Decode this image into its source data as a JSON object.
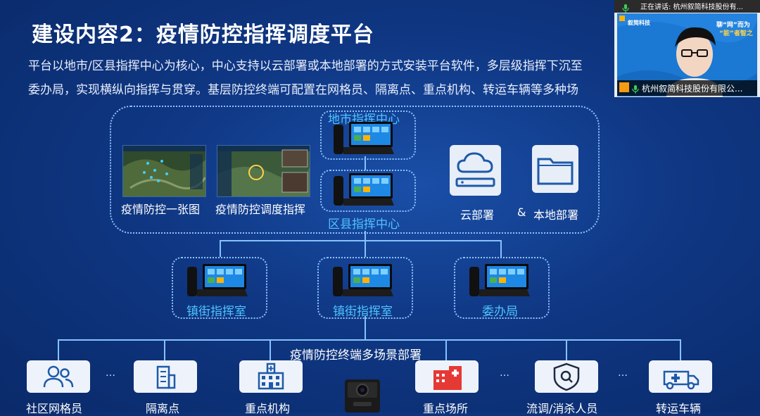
{
  "slide": {
    "title": "建设内容2：疫情防控指挥调度平台",
    "para_line1": "平台以地市/区县指挥中心为核心，中心支持以云部署或本地部署的方式安装平台软件，多层级指挥下沉至",
    "para_line2": "委办局，实现横纵向指挥与贯穿。基层防控终端可配置在网格员、隔离点、重点机构、转运车辆等多种场"
  },
  "top_panel": {
    "map1_label": "疫情防控一张图",
    "map2_label": "疫情防控调度指挥",
    "city_center": "地市指挥中心",
    "county_center": "区县指挥中心",
    "cloud_label": "云部署",
    "amp": "&",
    "local_label": "本地部署"
  },
  "mid_nodes": [
    {
      "label": "镇街指挥室"
    },
    {
      "label": "镇街指挥室"
    },
    {
      "label": "委办局"
    }
  ],
  "terminal_title": "疫情防控终端多场景部署",
  "terminals": [
    {
      "label": "社区网格员",
      "icon": "people-icon"
    },
    {
      "label": "隔离点",
      "icon": "building-icon"
    },
    {
      "label": "重点机构",
      "icon": "hospital-icon"
    },
    {
      "label": "重点场所",
      "icon": "venue-icon"
    },
    {
      "label": "流调/消杀人员",
      "icon": "shield-search-icon"
    },
    {
      "label": "转运车辆",
      "icon": "ambulance-icon"
    }
  ],
  "ellipsis": "…",
  "video": {
    "speaking": "正在讲话: 杭州叙简科技股份有...",
    "participant": "杭州叙简科技股份有限公...",
    "brand": "叙简科技",
    "banner_line1": "聊“网”而为",
    "banner_line2": "“能”者智之"
  },
  "colors": {
    "background": "#0f3783",
    "accent_blue": "#4fc3ff",
    "line": "#86c2ff",
    "venue_red": "#e53935"
  }
}
